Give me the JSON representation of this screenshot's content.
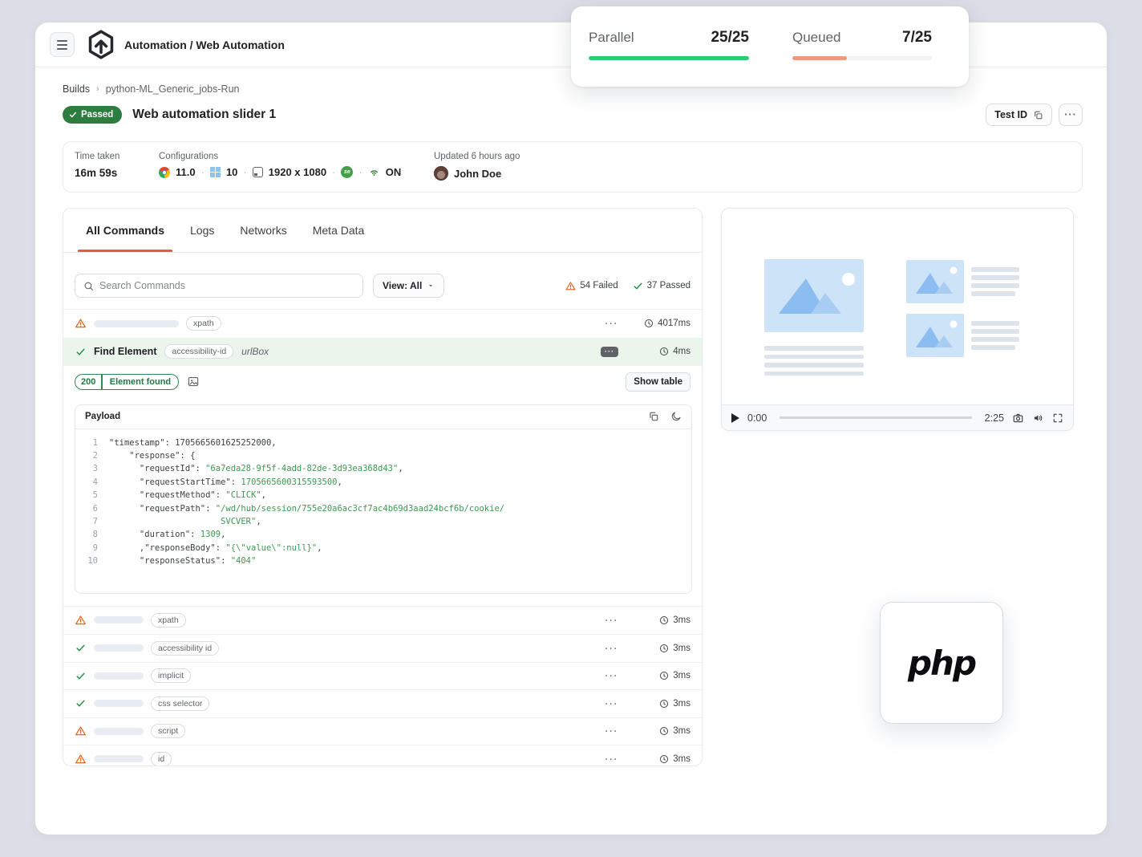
{
  "header": {
    "title": "Automation / Web Automation"
  },
  "stats": {
    "parallel_label": "Parallel",
    "parallel_value": "25/25",
    "parallel_pct": 100,
    "queued_label": "Queued",
    "queued_value": "7/25",
    "queued_pct": 39
  },
  "breadcrumb": {
    "root": "Builds",
    "current": "python-ML_Generic_jobs-Run"
  },
  "test": {
    "status": "Passed",
    "title": "Web automation slider 1",
    "test_id_label": "Test ID",
    "more_label": "···"
  },
  "info": {
    "time_taken_label": "Time taken",
    "time_taken": "16m 59s",
    "config_label": "Configurations",
    "browser_version": "11.0",
    "os_version": "10",
    "resolution": "1920 x 1080",
    "selenium_label": "se",
    "network_state": "ON",
    "separator": "·",
    "updated": "Updated 6 hours ago",
    "user": "John Doe"
  },
  "tabs": [
    {
      "label": "All Commands",
      "active": true
    },
    {
      "label": "Logs",
      "active": false
    },
    {
      "label": "Networks",
      "active": false
    },
    {
      "label": "Meta Data",
      "active": false
    }
  ],
  "commands": {
    "search_placeholder": "Search Commands",
    "view_label": "View: All",
    "failed": "54 Failed",
    "passed": "37 Passed",
    "menu_dots": "···",
    "top_row": {
      "status": "failed",
      "tag": "xpath",
      "time": "4017ms"
    },
    "selected_row": {
      "status": "passed",
      "name": "Find Element",
      "tag": "accessibility-id",
      "value": "urlBox",
      "time": "4ms"
    },
    "result_row": {
      "code": "200",
      "label": "Element found",
      "action": "Show table"
    },
    "rows": [
      {
        "status": "failed",
        "tag": "xpath",
        "time": "3ms"
      },
      {
        "status": "passed",
        "tag": "accessibility id",
        "time": "3ms"
      },
      {
        "status": "passed",
        "tag": "implicit",
        "time": "3ms"
      },
      {
        "status": "passed",
        "tag": "css selector",
        "time": "3ms"
      },
      {
        "status": "failed",
        "tag": "script",
        "time": "3ms"
      },
      {
        "status": "failed",
        "tag": "id",
        "time": "3ms"
      }
    ]
  },
  "payload": {
    "title": "Payload",
    "lines": [
      {
        "n": 1,
        "segs": [
          {
            "t": "\"timestamp\": 1705665601625252000,",
            "c": "d"
          }
        ]
      },
      {
        "n": 2,
        "segs": [
          {
            "t": "    \"response\": {",
            "c": "d"
          }
        ]
      },
      {
        "n": 3,
        "segs": [
          {
            "t": "      \"requestId\": ",
            "c": "d"
          },
          {
            "t": "\"6a7eda28-9f5f-4add-82de-3d93ea368d43\"",
            "c": "g"
          },
          {
            "t": ",",
            "c": "d"
          }
        ]
      },
      {
        "n": 4,
        "segs": [
          {
            "t": "      \"requestStartTime\": ",
            "c": "d"
          },
          {
            "t": "1705665600315593500",
            "c": "g"
          },
          {
            "t": ",",
            "c": "d"
          }
        ]
      },
      {
        "n": 5,
        "segs": [
          {
            "t": "      \"requestMethod\": ",
            "c": "d"
          },
          {
            "t": "\"CLICK\"",
            "c": "g"
          },
          {
            "t": ",",
            "c": "d"
          }
        ]
      },
      {
        "n": 6,
        "segs": [
          {
            "t": "      \"requestPath\": ",
            "c": "d"
          },
          {
            "t": "\"/wd/hub/session/755e20a6ac3cf7ac4b69d3aad24bcf6b/cookie/",
            "c": "g"
          }
        ]
      },
      {
        "n": 7,
        "segs": [
          {
            "t": "                      ",
            "c": "d"
          },
          {
            "t": "SVCVER\"",
            "c": "g"
          },
          {
            "t": ",",
            "c": "d"
          }
        ]
      },
      {
        "n": 8,
        "segs": [
          {
            "t": "      \"duration\": ",
            "c": "d"
          },
          {
            "t": "1309",
            "c": "g"
          },
          {
            "t": ",",
            "c": "d"
          }
        ]
      },
      {
        "n": 9,
        "segs": [
          {
            "t": "      ,\"responseBody\": ",
            "c": "d"
          },
          {
            "t": "\"{\\\"value\\\":null}\"",
            "c": "g"
          },
          {
            "t": ",",
            "c": "d"
          }
        ]
      },
      {
        "n": 10,
        "segs": [
          {
            "t": "      \"responseStatus\": ",
            "c": "d"
          },
          {
            "t": "\"404\"",
            "c": "g"
          }
        ]
      }
    ]
  },
  "player": {
    "current": "0:00",
    "duration": "2:25"
  },
  "php_card": {
    "label": "php"
  },
  "colors": {
    "accent_orange": "#ee5b27",
    "failed_orange": "#e8590c",
    "success_green": "#1e8e3e",
    "badge_green": "#2c7d3f",
    "parallel_bar": "#2fcb6f",
    "queued_bar": "#f09b77",
    "selected_row_bg": "#eaf6ec",
    "page_bg": "#dcdee7"
  }
}
